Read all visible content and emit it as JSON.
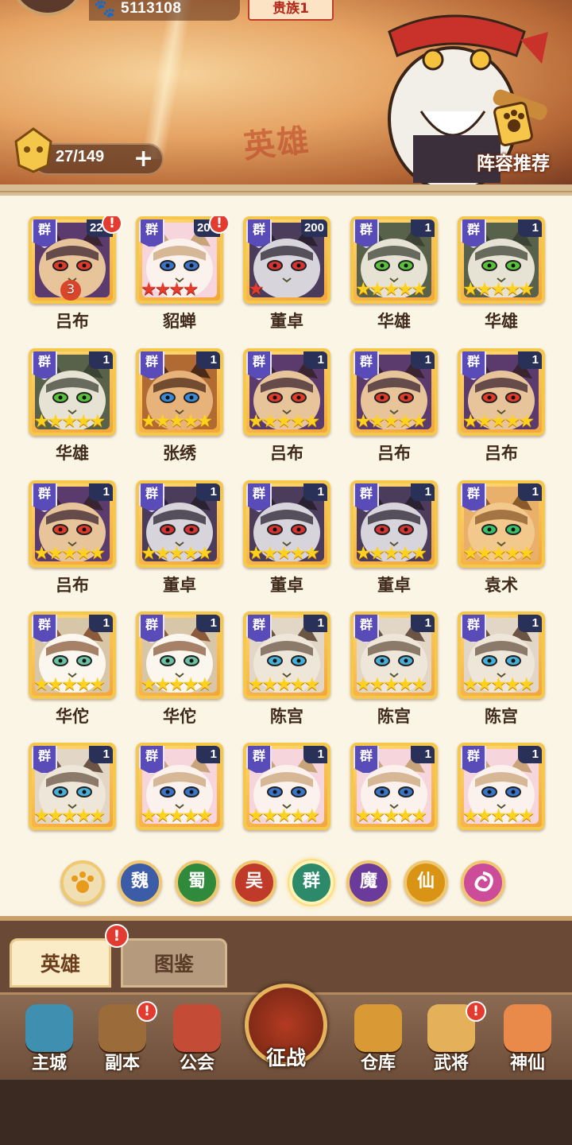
{
  "header": {
    "currency": "5113108",
    "noble_rank": "贵族1",
    "heading_deco": "英雄",
    "hero_count": "27/149",
    "plus": "+",
    "recommend_label": "阵容推荐"
  },
  "heroes": [
    {
      "name": "吕布",
      "faction": "群",
      "level": "228",
      "alert": "!",
      "stars": "3",
      "star_type": "red"
    },
    {
      "name": "貂蝉",
      "faction": "群",
      "level": "200",
      "alert": "!",
      "stars": "★★★★",
      "star_type": "red"
    },
    {
      "name": "董卓",
      "faction": "群",
      "level": "200",
      "alert": "",
      "stars": "★",
      "star_type": "red"
    },
    {
      "name": "华雄",
      "faction": "群",
      "level": "1",
      "alert": "",
      "stars": "★★★★★",
      "star_type": "gold"
    },
    {
      "name": "华雄",
      "faction": "群",
      "level": "1",
      "alert": "",
      "stars": "★★★★★",
      "star_type": "gold"
    },
    {
      "name": "华雄",
      "faction": "群",
      "level": "1",
      "alert": "",
      "stars": "★★★★★",
      "star_type": "gold"
    },
    {
      "name": "张绣",
      "faction": "群",
      "level": "1",
      "alert": "",
      "stars": "★★★★★",
      "star_type": "gold"
    },
    {
      "name": "吕布",
      "faction": "群",
      "level": "1",
      "alert": "",
      "stars": "★★★★★",
      "star_type": "gold"
    },
    {
      "name": "吕布",
      "faction": "群",
      "level": "1",
      "alert": "",
      "stars": "★★★★★",
      "star_type": "gold"
    },
    {
      "name": "吕布",
      "faction": "群",
      "level": "1",
      "alert": "",
      "stars": "★★★★★",
      "star_type": "gold"
    },
    {
      "name": "吕布",
      "faction": "群",
      "level": "1",
      "alert": "",
      "stars": "★★★★★",
      "star_type": "gold"
    },
    {
      "name": "董卓",
      "faction": "群",
      "level": "1",
      "alert": "",
      "stars": "★★★★★",
      "star_type": "gold"
    },
    {
      "name": "董卓",
      "faction": "群",
      "level": "1",
      "alert": "",
      "stars": "★★★★★",
      "star_type": "gold"
    },
    {
      "name": "董卓",
      "faction": "群",
      "level": "1",
      "alert": "",
      "stars": "★★★★★",
      "star_type": "gold"
    },
    {
      "name": "袁术",
      "faction": "群",
      "level": "1",
      "alert": "",
      "stars": "★★★★★",
      "star_type": "gold"
    },
    {
      "name": "华佗",
      "faction": "群",
      "level": "1",
      "alert": "",
      "stars": "★★★★★",
      "star_type": "gold"
    },
    {
      "name": "华佗",
      "faction": "群",
      "level": "1",
      "alert": "",
      "stars": "★★★★★",
      "star_type": "gold"
    },
    {
      "name": "陈宫",
      "faction": "群",
      "level": "1",
      "alert": "",
      "stars": "★★★★★",
      "star_type": "gold"
    },
    {
      "name": "陈宫",
      "faction": "群",
      "level": "1",
      "alert": "",
      "stars": "★★★★★",
      "star_type": "gold"
    },
    {
      "name": "陈宫",
      "faction": "群",
      "level": "1",
      "alert": "",
      "stars": "★★★★★",
      "star_type": "gold"
    },
    {
      "name": "",
      "faction": "群",
      "level": "1",
      "alert": "",
      "stars": "★★★★★",
      "star_type": "gold"
    },
    {
      "name": "",
      "faction": "群",
      "level": "1",
      "alert": "",
      "stars": "★★★★★",
      "star_type": "gold"
    },
    {
      "name": "",
      "faction": "群",
      "level": "1",
      "alert": "",
      "stars": "★★★★★",
      "star_type": "gold"
    },
    {
      "name": "",
      "faction": "群",
      "level": "1",
      "alert": "",
      "stars": "★★★★★",
      "star_type": "gold"
    },
    {
      "name": "",
      "faction": "群",
      "level": "1",
      "alert": "",
      "stars": "★★★★★",
      "star_type": "gold"
    }
  ],
  "hero_portraits": [
    "brown-cat-red-eyes",
    "white-pink-cat",
    "dark-cat-open-mouth",
    "gray-green-eye-cat",
    "gray-green-eye-cat",
    "gray-green-eye-cat",
    "brown-tabby-cat",
    "brown-cat-red-eyes",
    "brown-cat-red-eyes",
    "brown-cat-red-eyes",
    "brown-cat-red-eyes",
    "dark-cat-open-mouth",
    "dark-cat-open-mouth",
    "dark-cat-open-mouth",
    "orange-cat-green-eyes",
    "white-calico-cat",
    "white-calico-cat",
    "siamese-cat",
    "siamese-cat",
    "siamese-cat",
    "siamese-cat",
    "white-pink-cat",
    "white-pink-cat",
    "white-pink-cat",
    "white-pink-cat"
  ],
  "faction_filters": [
    {
      "label": "",
      "icon": "paw-icon",
      "color": "#f0dfb2"
    },
    {
      "label": "魏",
      "color": "#3d5ca8"
    },
    {
      "label": "蜀",
      "color": "#2f8a3c"
    },
    {
      "label": "吴",
      "color": "#c03a2a"
    },
    {
      "label": "群",
      "color": "#2c8a6a",
      "active": true
    },
    {
      "label": "魔",
      "color": "#6a3b9a"
    },
    {
      "label": "仙",
      "color": "#d99416"
    },
    {
      "label": "",
      "icon": "swirl-icon",
      "color": "#cc4c9a"
    }
  ],
  "tabs": {
    "heroes": "英雄",
    "codex": "图鉴",
    "alert": "!"
  },
  "nav": [
    {
      "label": "主城",
      "icon": "castle-icon",
      "color": "#3f8fb0",
      "alert": ""
    },
    {
      "label": "副本",
      "icon": "sword-icon",
      "color": "#9b6b3a",
      "alert": "!"
    },
    {
      "label": "公会",
      "icon": "flag-icon",
      "color": "#c44b36",
      "alert": ""
    },
    {
      "label": "征战",
      "icon": "battle-icon",
      "color": "#b43b22",
      "alert": ""
    },
    {
      "label": "仓库",
      "icon": "treasure-bag-icon",
      "color": "#d99a36",
      "alert": ""
    },
    {
      "label": "武将",
      "icon": "cat-hero-icon",
      "color": "#e4b15a",
      "alert": "!"
    },
    {
      "label": "神仙",
      "icon": "fortune-cat-icon",
      "color": "#e98a4a",
      "alert": ""
    }
  ],
  "colors": {
    "panel": "#fbf5e6",
    "frame_gold": "#f5c74a",
    "faction_badge": "#5a4cb8",
    "alert": "#e43b30"
  }
}
